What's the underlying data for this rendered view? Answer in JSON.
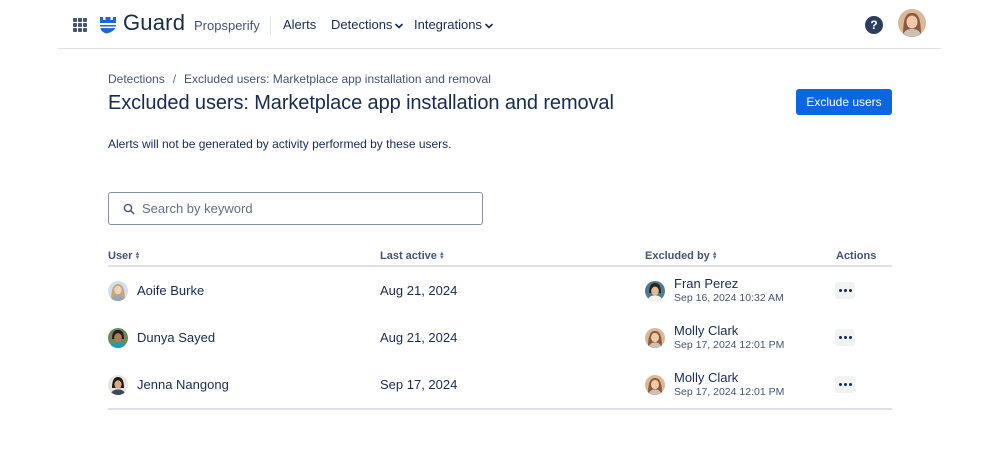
{
  "nav": {
    "product_name": "Guard",
    "site_name": "Propsperify",
    "items": [
      {
        "label": "Alerts"
      },
      {
        "label": "Detections"
      },
      {
        "label": "Integrations"
      }
    ],
    "help_label": "?"
  },
  "breadcrumb": [
    {
      "label": "Detections"
    },
    {
      "label": "Excluded users: Marketplace app installation and removal"
    }
  ],
  "page": {
    "title": "Excluded users: Marketplace app installation and removal",
    "primary_action": "Exclude users",
    "description": "Alerts will not be generated by activity performed by these users."
  },
  "search": {
    "placeholder": "Search by keyword",
    "value": ""
  },
  "table": {
    "columns": [
      "User",
      "Last active",
      "Excluded by",
      "Actions"
    ],
    "rows": [
      {
        "user": "Aoife Burke",
        "last_active": "Aug 21, 2024",
        "excluded_by": "Fran Perez",
        "excluded_at": "Sep 16, 2024 10:32 AM"
      },
      {
        "user": "Dunya Sayed",
        "last_active": "Aug 21, 2024",
        "excluded_by": "Molly Clark",
        "excluded_at": "Sep 17, 2024 12:01 PM"
      },
      {
        "user": "Jenna Nangong",
        "last_active": "Sep 17, 2024",
        "excluded_by": "Molly Clark",
        "excluded_at": "Sep 17, 2024 12:01 PM"
      }
    ]
  },
  "colors": {
    "primary": "#0c66e4",
    "text": "#172b4d",
    "subtle_text": "#44546f",
    "logo_blue": "#1868db"
  }
}
